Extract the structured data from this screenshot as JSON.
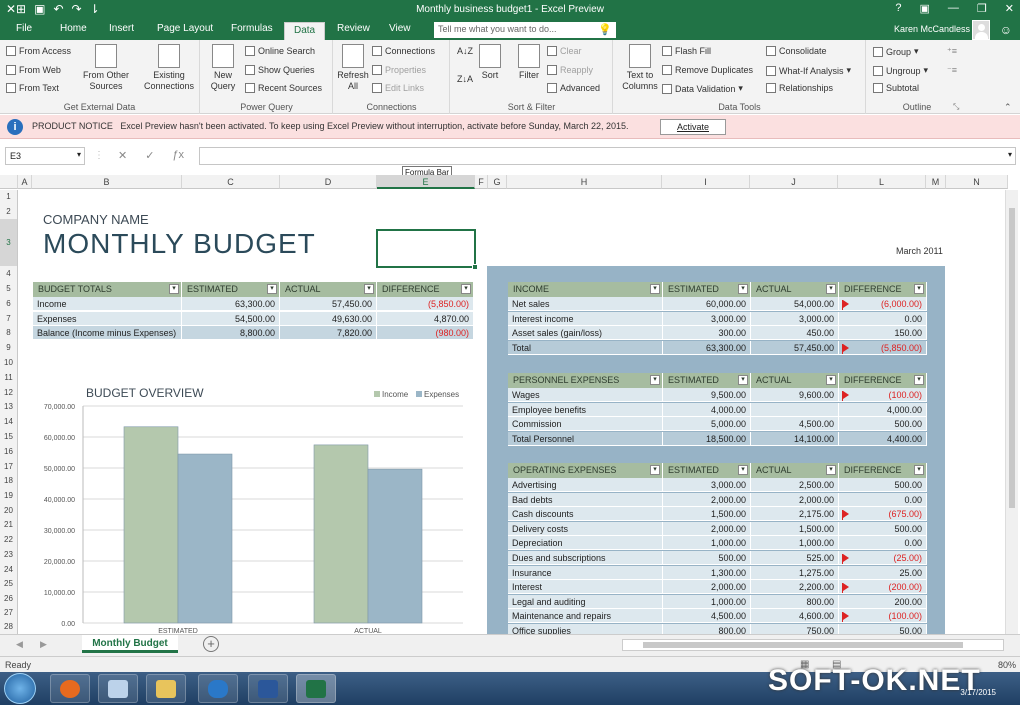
{
  "app": {
    "title": "Monthly business budget1 - Excel Preview",
    "user": "Karen McCandless",
    "help": "?"
  },
  "tabs": [
    "File",
    "Home",
    "Insert",
    "Page Layout",
    "Formulas",
    "Data",
    "Review",
    "View"
  ],
  "tell_me": "Tell me what you want to do...",
  "ribbon": {
    "get_external": {
      "label": "Get External Data",
      "from_access": "From Access",
      "from_web": "From Web",
      "from_text": "From Text",
      "from_other": "From Other",
      "from_other2": "Sources",
      "existing": "Existing",
      "existing2": "Connections"
    },
    "power_query": {
      "label": "Power Query",
      "new_query": "New",
      "new_query2": "Query",
      "online_search": "Online Search",
      "show_queries": "Show Queries",
      "recent_sources": "Recent Sources"
    },
    "connections": {
      "label": "Connections",
      "refresh": "Refresh",
      "refresh2": "All",
      "connections": "Connections",
      "properties": "Properties",
      "edit_links": "Edit Links"
    },
    "sort_filter": {
      "label": "Sort & Filter",
      "sort": "Sort",
      "filter": "Filter",
      "clear": "Clear",
      "reapply": "Reapply",
      "advanced": "Advanced"
    },
    "data_tools": {
      "label": "Data Tools",
      "text_to_columns": "Text to",
      "text_to_columns2": "Columns",
      "flash_fill": "Flash Fill",
      "remove_dup": "Remove Duplicates",
      "data_validation": "Data Validation",
      "consolidate": "Consolidate",
      "what_if": "What-If Analysis",
      "relationships": "Relationships"
    },
    "outline": {
      "label": "Outline",
      "group": "Group",
      "ungroup": "Ungroup",
      "subtotal": "Subtotal"
    }
  },
  "notice": {
    "title": "PRODUCT NOTICE",
    "text": "Excel Preview hasn't been activated. To keep using Excel Preview without interruption, activate before Sunday, March 22, 2015.",
    "button": "Activate"
  },
  "name_box": "E3",
  "formula_tooltip": "Formula Bar",
  "columns": [
    "A",
    "B",
    "C",
    "D",
    "E",
    "F",
    "G",
    "H",
    "I",
    "J",
    "L",
    "M",
    "N"
  ],
  "rows": [
    "1",
    "2",
    "3",
    "4",
    "5",
    "6",
    "7",
    "8",
    "9",
    "10",
    "11",
    "12",
    "13",
    "14",
    "15",
    "16",
    "17",
    "18",
    "19",
    "20",
    "21",
    "22",
    "23",
    "24",
    "25",
    "26",
    "27",
    "28"
  ],
  "sheet": {
    "company": "COMPANY NAME",
    "title": "MONTHLY BUDGET",
    "month": "March 2011"
  },
  "budget_totals": {
    "headers": [
      "BUDGET TOTALS",
      "ESTIMATED",
      "ACTUAL",
      "DIFFERENCE"
    ],
    "rows": [
      [
        "Income",
        "63,300.00",
        "57,450.00",
        "(5,850.00)"
      ],
      [
        "Expenses",
        "54,500.00",
        "49,630.00",
        "4,870.00"
      ],
      [
        "Balance (Income minus Expenses)",
        "8,800.00",
        "7,820.00",
        "(980.00)"
      ]
    ]
  },
  "income": {
    "headers": [
      "INCOME",
      "ESTIMATED",
      "ACTUAL",
      "DIFFERENCE"
    ],
    "rows": [
      [
        "Net sales",
        "60,000.00",
        "54,000.00",
        "(6,000.00)"
      ],
      [
        "Interest income",
        "3,000.00",
        "3,000.00",
        "0.00"
      ],
      [
        "Asset sales (gain/loss)",
        "300.00",
        "450.00",
        "150.00"
      ],
      [
        "Total",
        "63,300.00",
        "57,450.00",
        "(5,850.00)"
      ]
    ]
  },
  "personnel": {
    "headers": [
      "PERSONNEL EXPENSES",
      "ESTIMATED",
      "ACTUAL",
      "DIFFERENCE"
    ],
    "rows": [
      [
        "Wages",
        "9,500.00",
        "9,600.00",
        "(100.00)"
      ],
      [
        "Employee benefits",
        "4,000.00",
        "",
        "4,000.00"
      ],
      [
        "Commission",
        "5,000.00",
        "4,500.00",
        "500.00"
      ],
      [
        "Total Personnel",
        "18,500.00",
        "14,100.00",
        "4,400.00"
      ]
    ]
  },
  "operating": {
    "headers": [
      "OPERATING EXPENSES",
      "ESTIMATED",
      "ACTUAL",
      "DIFFERENCE"
    ],
    "rows": [
      [
        "Advertising",
        "3,000.00",
        "2,500.00",
        "500.00"
      ],
      [
        "Bad debts",
        "2,000.00",
        "2,000.00",
        "0.00"
      ],
      [
        "Cash discounts",
        "1,500.00",
        "2,175.00",
        "(675.00)"
      ],
      [
        "Delivery costs",
        "2,000.00",
        "1,500.00",
        "500.00"
      ],
      [
        "Depreciation",
        "1,000.00",
        "1,000.00",
        "0.00"
      ],
      [
        "Dues and subscriptions",
        "500.00",
        "525.00",
        "(25.00)"
      ],
      [
        "Insurance",
        "1,300.00",
        "1,275.00",
        "25.00"
      ],
      [
        "Interest",
        "2,000.00",
        "2,200.00",
        "(200.00)"
      ],
      [
        "Legal and auditing",
        "1,000.00",
        "800.00",
        "200.00"
      ],
      [
        "Maintenance and repairs",
        "4,500.00",
        "4,600.00",
        "(100.00)"
      ],
      [
        "Office supplies",
        "800.00",
        "750.00",
        "50.00"
      ]
    ]
  },
  "chart_data": {
    "type": "bar",
    "title": "BUDGET OVERVIEW",
    "categories": [
      "ESTIMATED",
      "ACTUAL"
    ],
    "series": [
      {
        "name": "Income",
        "values": [
          63300,
          57450
        ],
        "color": "#b4c8ad"
      },
      {
        "name": "Expenses",
        "values": [
          54500,
          49630
        ],
        "color": "#9bb6c7"
      }
    ],
    "ylim": [
      0,
      70000
    ],
    "yticks": [
      "0.00",
      "10,000.00",
      "20,000.00",
      "30,000.00",
      "40,000.00",
      "50,000.00",
      "60,000.00",
      "70,000.00"
    ],
    "legend": "top-right",
    "grid": true
  },
  "sheet_tab": "Monthly Budget",
  "status": {
    "ready": "Ready",
    "zoom": "80%"
  },
  "watermark": "SOFT-OK.NET",
  "taskbar_date": "3/17/2015",
  "colors": {
    "excel_green": "#217346",
    "header_green": "#a6bca0",
    "panel_blue": "#97b3c6",
    "negative": "#d22222"
  }
}
